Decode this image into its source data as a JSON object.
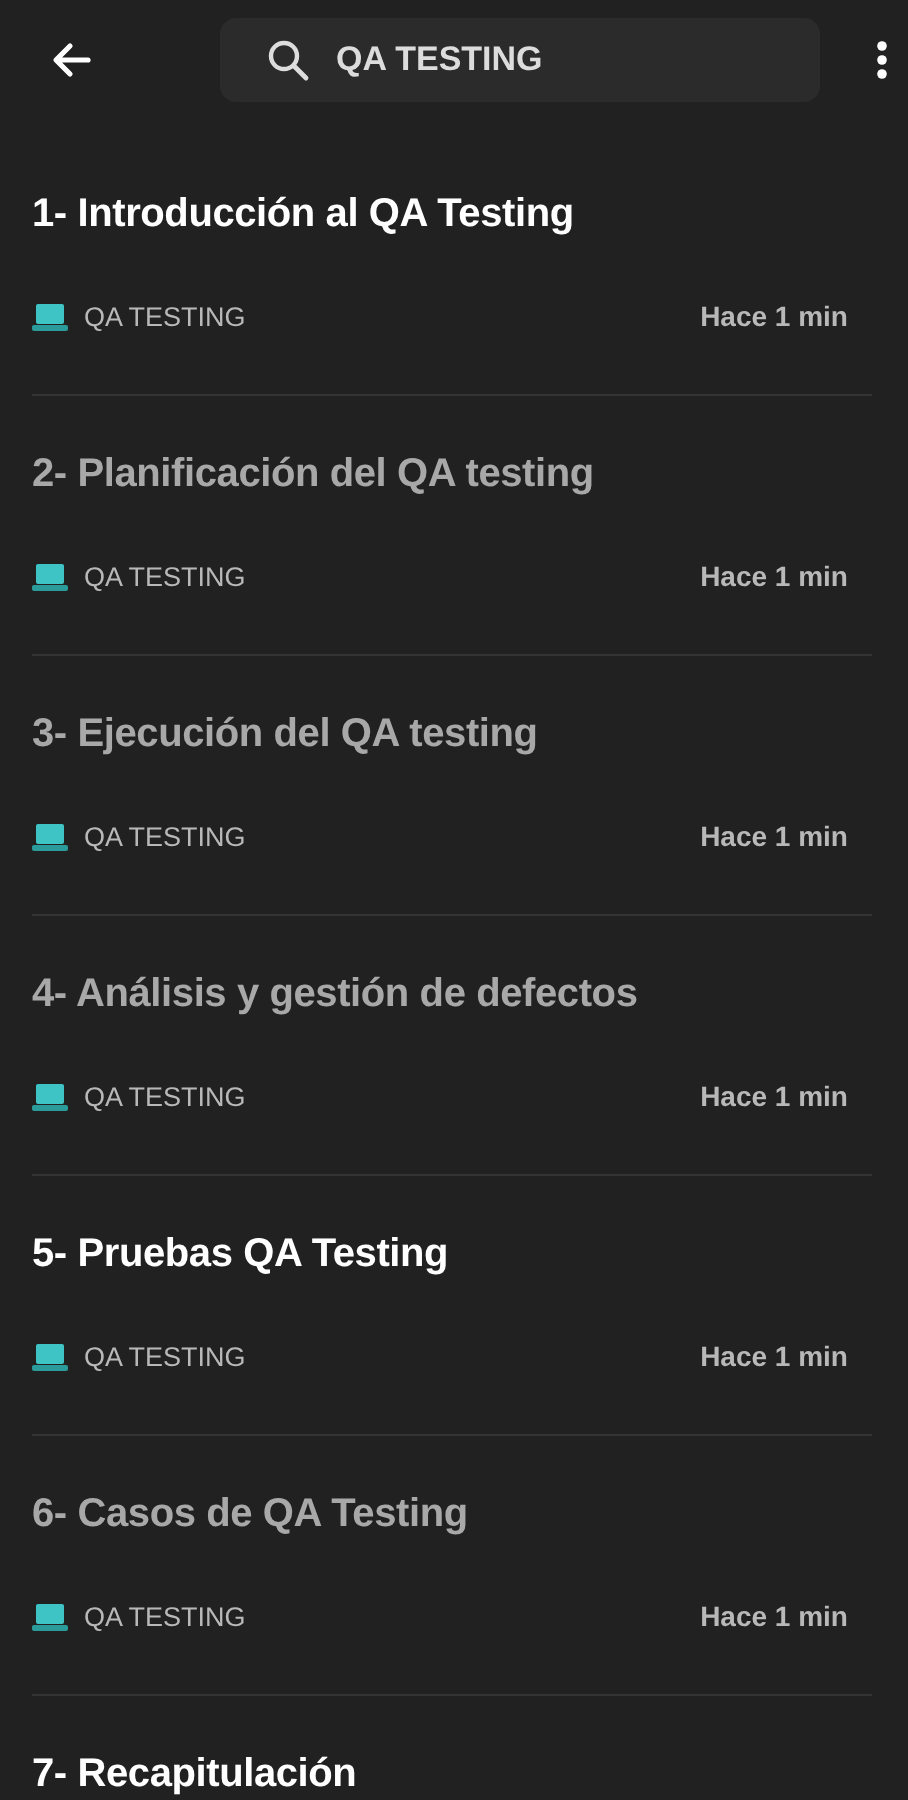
{
  "search": {
    "value": "QA TESTING"
  },
  "items": [
    {
      "title": "1- Introducción al QA Testing",
      "category": "QA TESTING",
      "time": "Hace 1 min",
      "read": false
    },
    {
      "title": "2- Planificación del QA testing",
      "category": "QA TESTING",
      "time": "Hace 1 min",
      "read": true
    },
    {
      "title": "3- Ejecución del QA testing",
      "category": "QA TESTING",
      "time": "Hace 1 min",
      "read": true
    },
    {
      "title": "4- Análisis y gestión de defectos",
      "category": "QA TESTING",
      "time": "Hace 1 min",
      "read": true
    },
    {
      "title": "5- Pruebas QA Testing",
      "category": "QA TESTING",
      "time": "Hace 1 min",
      "read": false
    },
    {
      "title": "6- Casos de QA Testing",
      "category": "QA TESTING",
      "time": "Hace 1 min",
      "read": true
    },
    {
      "title": "7- Recapitulación",
      "read": false
    }
  ]
}
